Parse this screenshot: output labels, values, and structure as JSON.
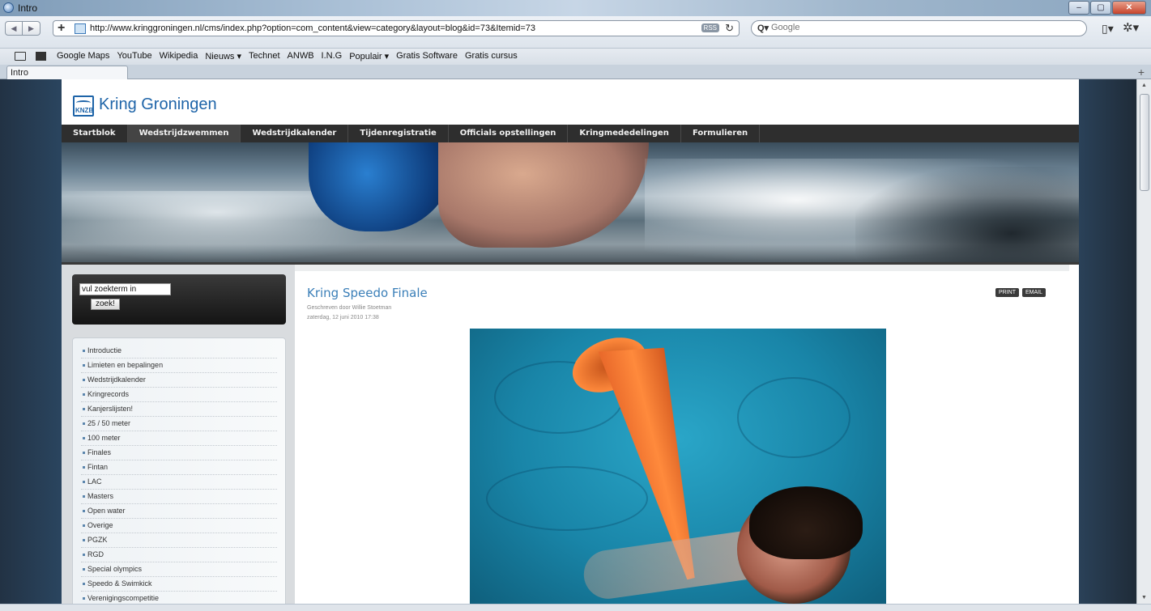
{
  "window": {
    "title": "Intro",
    "controls": {
      "minimize": "–",
      "maximize": "▢",
      "close": "✕"
    }
  },
  "toolbar": {
    "back_icon": "◀",
    "forward_icon": "▶",
    "add_icon": "+",
    "url": "http://www.kringgroningen.nl/cms/index.php?option=com_content&view=category&layout=blog&id=73&Itemid=73",
    "rss_label": "RSS",
    "reload_icon": "↻",
    "search_icon": "Q▾",
    "search_placeholder": "Google",
    "page_menu_icon": "▯▾",
    "settings_icon": "✲▾"
  },
  "bookmarks": {
    "items": [
      "Google Maps",
      "YouTube",
      "Wikipedia",
      "Nieuws ▾",
      "Technet",
      "ANWB",
      "I.N.G",
      "Populair ▾",
      "Gratis Software",
      "Gratis cursus"
    ]
  },
  "tabs": [
    {
      "label": "Intro"
    }
  ],
  "tabstrip": {
    "new_tab": "+"
  },
  "site": {
    "logo_abbr": "KNZB",
    "title": "Kring Groningen",
    "nav": [
      {
        "label": "Startblok"
      },
      {
        "label": "Wedstrijdzwemmen",
        "active": true
      },
      {
        "label": "Wedstrijdkalender"
      },
      {
        "label": "Tijdenregistratie"
      },
      {
        "label": "Officials opstellingen"
      },
      {
        "label": "Kringmededelingen"
      },
      {
        "label": "Formulieren"
      }
    ],
    "search": {
      "value": "vul zoekterm in",
      "button": "zoek!"
    },
    "menu": [
      "Introductie",
      "Limieten en bepalingen",
      "Wedstrijdkalender",
      "Kringrecords",
      "Kanjerslijsten!",
      "25 / 50 meter",
      "100 meter",
      "Finales",
      "Fintan",
      "LAC",
      "Masters",
      "Open water",
      "Overige",
      "PGZK",
      "RGD",
      "Special olympics",
      "Speedo & Swimkick",
      "Verenigingscompetitie"
    ],
    "article": {
      "title": "Kring Speedo Finale",
      "author": "Geschreven door Willie Stoetman",
      "date": "zaterdag, 12 juni 2010 17:38",
      "print_label": "PRINT",
      "email_label": "EMAIL"
    }
  },
  "scrollbar": {
    "up": "▲",
    "down": "▼"
  }
}
